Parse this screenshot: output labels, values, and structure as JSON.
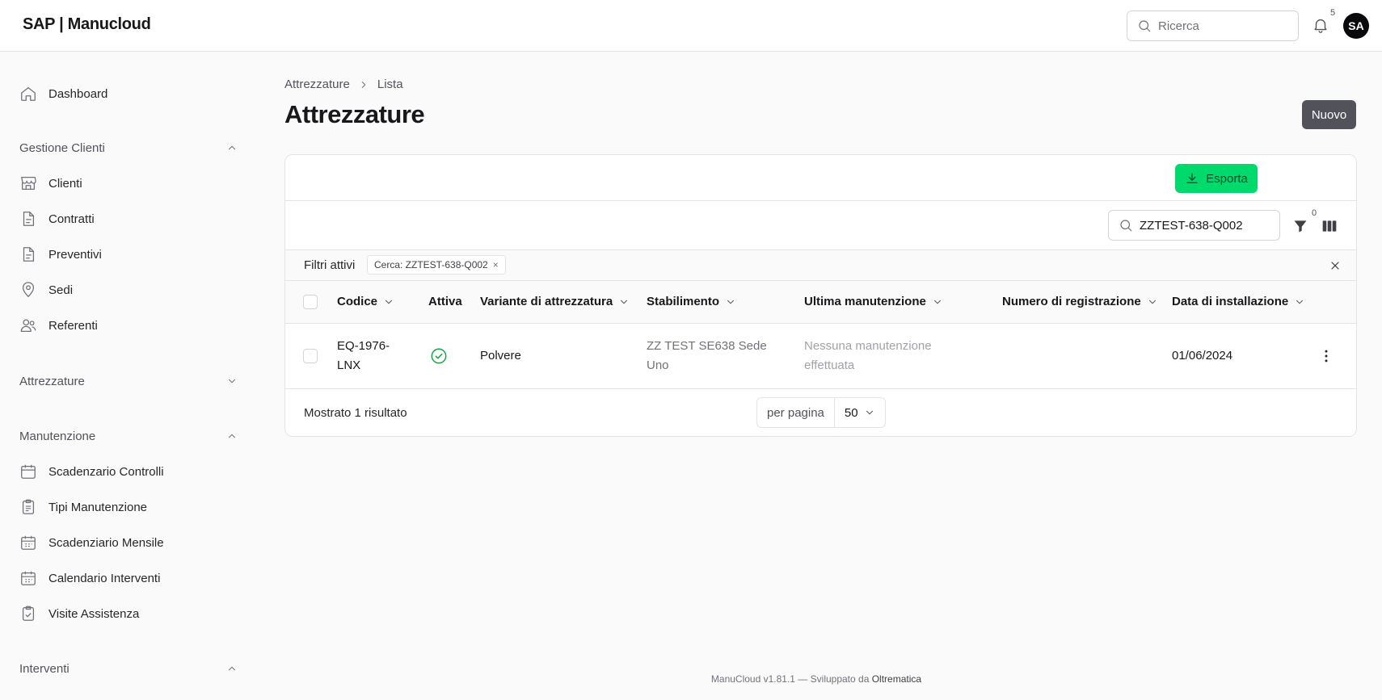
{
  "header": {
    "brand": "SAP | Manucloud",
    "search_placeholder": "Ricerca",
    "notifications_count": "5",
    "avatar_initials": "SA"
  },
  "sidebar": {
    "dashboard": {
      "label": "Dashboard",
      "icon": "home-icon"
    },
    "sections": [
      {
        "title": "Gestione Clienti",
        "expanded": true,
        "items": [
          {
            "label": "Clienti",
            "icon": "store-icon"
          },
          {
            "label": "Contratti",
            "icon": "document-icon"
          },
          {
            "label": "Preventivi",
            "icon": "document-icon"
          },
          {
            "label": "Sedi",
            "icon": "map-pin-icon"
          },
          {
            "label": "Referenti",
            "icon": "users-icon"
          }
        ]
      },
      {
        "title": "Attrezzature",
        "expanded": false,
        "items": []
      },
      {
        "title": "Manutenzione",
        "expanded": true,
        "items": [
          {
            "label": "Scadenzario Controlli",
            "icon": "calendar-icon"
          },
          {
            "label": "Tipi Manutenzione",
            "icon": "clipboard-icon"
          },
          {
            "label": "Scadenziario Mensile",
            "icon": "calendar-icon"
          },
          {
            "label": "Calendario Interventi",
            "icon": "calendar-icon"
          },
          {
            "label": "Visite Assistenza",
            "icon": "clipboard-check-icon"
          }
        ]
      },
      {
        "title": "Interventi",
        "expanded": true,
        "items": []
      }
    ]
  },
  "breadcrumb": [
    "Attrezzature",
    "Lista"
  ],
  "page": {
    "title": "Attrezzature",
    "new_button": "Nuovo"
  },
  "toolbar": {
    "export_button": "Esporta",
    "search_value": "ZZTEST-638-Q002",
    "filters_count": "0"
  },
  "active_filters": {
    "label": "Filtri attivi",
    "chips": [
      "Cerca: ZZTEST-638-Q002"
    ],
    "chip_remove": "×"
  },
  "table": {
    "columns": [
      "Codice",
      "Attiva",
      "Variante di attrezzatura",
      "Stabilimento",
      "Ultima manutenzione",
      "Numero di registrazione",
      "Data di installazione"
    ],
    "rows": [
      {
        "codice_line1": "EQ-1976-",
        "codice_line2": "LNX",
        "attiva": true,
        "variante": "Polvere",
        "stabilimento_line1": "ZZ TEST SE638 Sede",
        "stabilimento_line2": "Uno",
        "ultima_line1": "Nessuna manutenzione",
        "ultima_line2": "effettuata",
        "numero_registrazione": "",
        "data_installazione": "01/06/2024"
      }
    ]
  },
  "pagination": {
    "result_text": "Mostrato 1 risultato",
    "per_page_label": "per pagina",
    "per_page_value": "50"
  },
  "footer": {
    "text": "ManuCloud v1.81.1 — Sviluppato da",
    "developer": "Oltrematica"
  },
  "colors": {
    "export": "#00d96b",
    "active_status": "#16a34a",
    "new_button": "#52525b"
  }
}
